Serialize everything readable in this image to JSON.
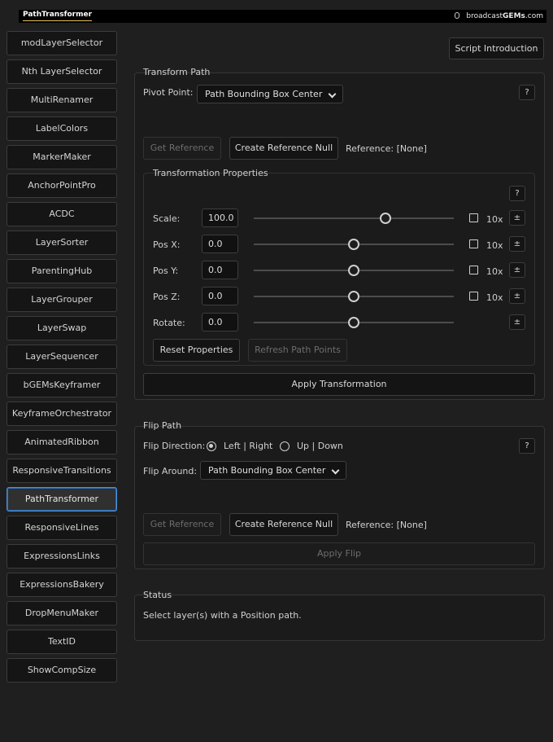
{
  "header": {
    "logo": "PathTransformer",
    "brand_prefix": "broadcast",
    "brand_bold": "GEMs",
    "brand_suffix": ".com"
  },
  "sidebar": {
    "items": [
      {
        "label": "modLayerSelector"
      },
      {
        "label": "Nth LayerSelector"
      },
      {
        "label": "MultiRenamer"
      },
      {
        "label": "LabelColors"
      },
      {
        "label": "MarkerMaker"
      },
      {
        "label": "AnchorPointPro"
      },
      {
        "label": "ACDC"
      },
      {
        "label": "LayerSorter"
      },
      {
        "label": "ParentingHub"
      },
      {
        "label": "LayerGrouper"
      },
      {
        "label": "LayerSwap"
      },
      {
        "label": "LayerSequencer"
      },
      {
        "label": "bGEMsKeyframer"
      },
      {
        "label": "KeyframeOrchestrator"
      },
      {
        "label": "AnimatedRibbon"
      },
      {
        "label": "ResponsiveTransitions"
      },
      {
        "label": "PathTransformer"
      },
      {
        "label": "ResponsiveLines"
      },
      {
        "label": "ExpressionsLinks"
      },
      {
        "label": "ExpressionsBakery"
      },
      {
        "label": "DropMenuMaker"
      },
      {
        "label": "TextID"
      },
      {
        "label": "ShowCompSize"
      }
    ],
    "active_index": 16
  },
  "script_intro_label": "Script Introduction",
  "transform": {
    "title": "Transform Path",
    "pivot_label": "Pivot Point:",
    "pivot_value": "Path Bounding Box Center",
    "help": "?",
    "get_ref": "Get Reference",
    "create_null": "Create Reference Null",
    "reference": "Reference: [None]",
    "props_title": "Transformation Properties",
    "rows": [
      {
        "label": "Scale:",
        "value": "100.0",
        "slider": 0.66,
        "multiplier": "10x"
      },
      {
        "label": "Pos X:",
        "value": "0.0",
        "slider": 0.5,
        "multiplier": "10x"
      },
      {
        "label": "Pos Y:",
        "value": "0.0",
        "slider": 0.5,
        "multiplier": "10x"
      },
      {
        "label": "Pos Z:",
        "value": "0.0",
        "slider": 0.5,
        "multiplier": "10x"
      },
      {
        "label": "Rotate:",
        "value": "0.0",
        "slider": 0.5,
        "multiplier": ""
      }
    ],
    "plusminus": "±",
    "reset": "Reset Properties",
    "refresh": "Refresh Path Points",
    "apply": "Apply Transformation"
  },
  "flip": {
    "title": "Flip Path",
    "direction_label": "Flip Direction:",
    "opt1": "Left | Right",
    "opt2": "Up | Down",
    "around_label": "Flip Around:",
    "around_value": "Path Bounding Box Center",
    "help": "?",
    "get_ref": "Get Reference",
    "create_null": "Create Reference Null",
    "reference": "Reference: [None]",
    "apply": "Apply Flip"
  },
  "status": {
    "title": "Status",
    "message": "Select layer(s) with a Position path."
  }
}
